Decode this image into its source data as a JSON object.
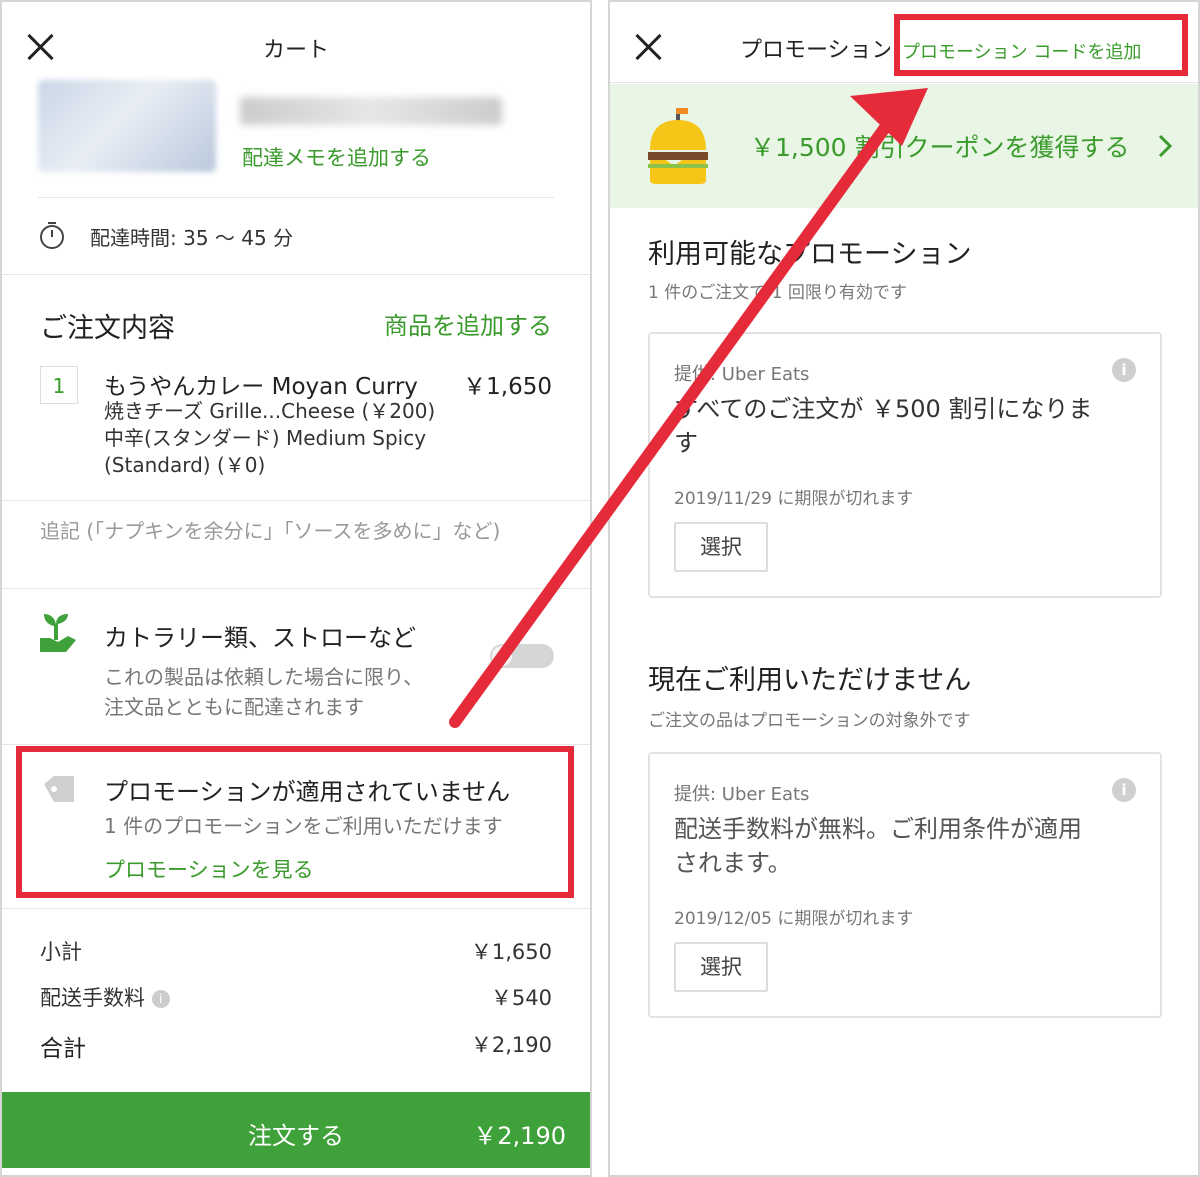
{
  "cart": {
    "title": "カート",
    "add_delivery_note": "配達メモを追加する",
    "delivery_time": "配達時間: 35 〜 45 分",
    "order_section_title": "ご注文内容",
    "add_items": "商品を追加する",
    "item": {
      "quantity": "1",
      "name": "もうやんカレー Moyan Curry",
      "price": "￥1,650",
      "options": [
        "焼きチーズ Grille...Cheese (￥200)",
        "中辛(スタンダード) Medium Spicy",
        "(Standard) (￥0)"
      ]
    },
    "note_placeholder": "追記 (「ナプキンを余分に」「ソースを多めに」など)",
    "cutlery": {
      "title": "カトラリー類、ストローなど",
      "desc_line1": "これの製品は依頼した場合に限り、",
      "desc_line2": "注文品とともに配達されます"
    },
    "promo": {
      "title": "プロモーションが適用されていません",
      "subtitle": "1 件のプロモーションをご利用いただけます",
      "link": "プロモーションを見る"
    },
    "summary": {
      "subtotal_label": "小計",
      "subtotal": "￥1,650",
      "delivery_fee_label": "配送手数料",
      "delivery_fee": "￥540",
      "total_label": "合計",
      "total": "￥2,190"
    },
    "order_button": {
      "label": "注文する",
      "amount": "￥2,190"
    }
  },
  "promotions": {
    "title": "プロモーション",
    "add_code": "プロモーション コードを追加",
    "banner_text": "￥1,500 割引クーポンを獲得する",
    "available_title": "利用可能なプロモーション",
    "available_subtitle": "1 件のご注文で 1 回限り有効です",
    "available_card": {
      "provider": "提供: Uber Eats",
      "desc_line1": "すべてのご注文が ￥500 割引になりま",
      "desc_line2": "す",
      "expiry": "2019/11/29 に期限が切れます",
      "select": "選択"
    },
    "unavailable_title": "現在ご利用いただけません",
    "unavailable_subtitle": "ご注文の品はプロモーションの対象外です",
    "unavailable_card": {
      "provider": "提供: Uber Eats",
      "desc_line1": "配送手数料が無料。ご利用条件が適用",
      "desc_line2": "されます。",
      "expiry": "2019/12/05 に期限が切れます",
      "select": "選択"
    }
  },
  "colors": {
    "brand_green": "#3fa13a",
    "link_green": "#3a9b2c",
    "highlight_red": "#e52b3a"
  }
}
